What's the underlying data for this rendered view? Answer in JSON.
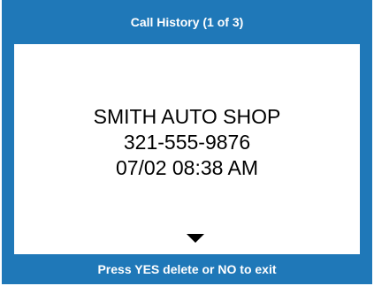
{
  "header": {
    "title": "Call History (1 of 3)"
  },
  "entry": {
    "name": "SMITH AUTO SHOP",
    "number": "321-555-9876",
    "datetime": "07/02 08:38 AM"
  },
  "footer": {
    "instruction": "Press YES delete or NO to exit"
  },
  "icons": {
    "scroll": "down-triangle-icon"
  },
  "colors": {
    "frame": "#1f78b8",
    "content_bg": "#ffffff",
    "text_on_frame": "#ffffff",
    "text_main": "#000000"
  }
}
